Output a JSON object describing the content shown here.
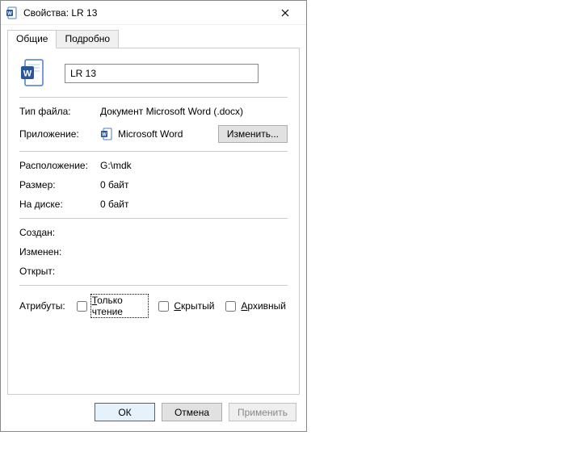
{
  "titlebar": {
    "title": "Свойства: LR 13",
    "icon": "word-doc-icon"
  },
  "tabs": {
    "general": "Общие",
    "details": "Подробно"
  },
  "filename": {
    "value": "LR 13"
  },
  "labels": {
    "file_type": "Тип файла:",
    "application": "Приложение:",
    "location": "Расположение:",
    "size": "Размер:",
    "size_on_disk": "На диске:",
    "created": "Создан:",
    "modified": "Изменен:",
    "accessed": "Открыт:",
    "attributes": "Атрибуты:"
  },
  "values": {
    "file_type": "Документ Microsoft Word (.docx)",
    "application": "Microsoft Word",
    "location": "G:\\mdk",
    "size": "0 байт",
    "size_on_disk": "0 байт",
    "created": "",
    "modified": "",
    "accessed": ""
  },
  "buttons": {
    "change": "Изменить...",
    "ok": "ОК",
    "cancel": "Отмена",
    "apply": "Применить"
  },
  "attributes": {
    "readonly_prefix": "Т",
    "readonly_rest": "олько чтение",
    "hidden_prefix": "С",
    "hidden_rest": "крытый",
    "archive_prefix": "А",
    "archive_rest": "рхивный"
  },
  "icons": {
    "title_icon": "word-doc-small",
    "app_icon": "word-app-small",
    "big_icon": "word-doc-large"
  }
}
